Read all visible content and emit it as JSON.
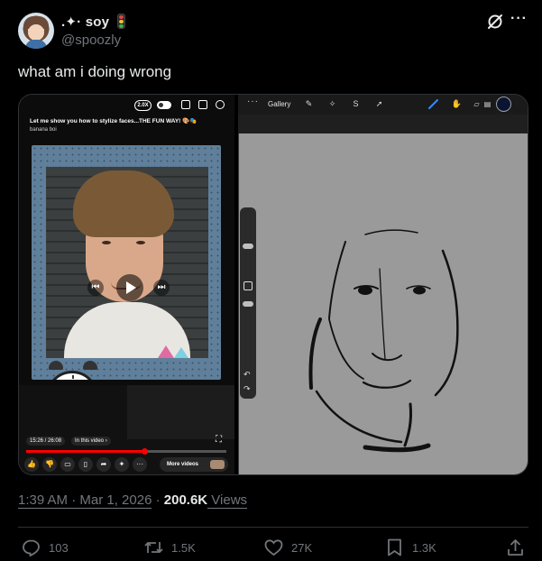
{
  "author": {
    "display_name": ".✦· soy",
    "handle": "@spoozly"
  },
  "tweet": {
    "text": "what am i doing wrong"
  },
  "video": {
    "speed": "2.0X",
    "title": "Let me show you how to stylize faces...THE FUN WAY! 🎨🎭",
    "channel": "banana boi",
    "timestamp": "15:26 / 26:08",
    "chapter_label": "In this video",
    "chapter_arrow": "›",
    "progress_fraction": 0.59,
    "more_videos_label": "More videos"
  },
  "procreate": {
    "gallery_label": "Gallery",
    "gallery_dots": "···"
  },
  "meta": {
    "timestamp": "1:39 AM · Mar 1, 2026",
    "separator": " · ",
    "views_count": "200.6K",
    "views_label": " Views"
  },
  "stats": {
    "replies": "103",
    "reposts": "1.5K",
    "likes": "27K",
    "bookmarks": "1.3K"
  },
  "colors": {
    "background": "#000000",
    "text_primary": "#e7e9ea",
    "text_secondary": "#71767b",
    "border": "#2f3336",
    "progress_red": "#ff0000",
    "canvas_gray": "#9a9a9a"
  }
}
